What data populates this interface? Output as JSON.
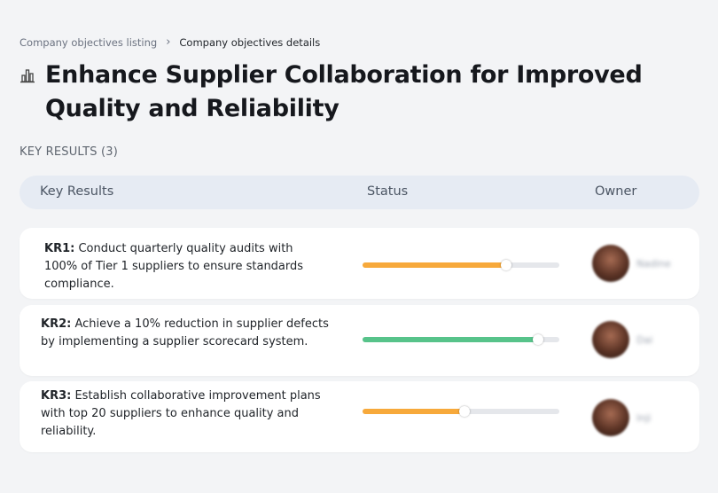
{
  "breadcrumb": {
    "parent": "Company objectives listing",
    "separator": "›",
    "current": "Company objectives details"
  },
  "page": {
    "title": "Enhance Supplier Collaboration for Improved Quality and Reliability",
    "icon": "bar-chart-icon"
  },
  "key_results_section": {
    "label": "KEY RESULTS (3)"
  },
  "table": {
    "headers": [
      "Key Results",
      "Status",
      "Owner"
    ]
  },
  "key_results": [
    {
      "code": "KR1:",
      "text": "Conduct quarterly quality audits with 100% of Tier 1 suppliers to ensure standards compliance.",
      "progress": 0.73,
      "color": "#f7a93b",
      "owner": "Nadine"
    },
    {
      "code": "KR2:",
      "text": "Achieve a 10% reduction in supplier defects by implementing a supplier scorecard system.",
      "progress": 0.89,
      "color": "#57c38a",
      "owner": "Dai"
    },
    {
      "code": "KR3:",
      "text": "Establish collaborative improvement plans with top 20 suppliers to enhance quality and reliability.",
      "progress": 0.52,
      "color": "#f7a93b",
      "owner": "Inji"
    }
  ]
}
